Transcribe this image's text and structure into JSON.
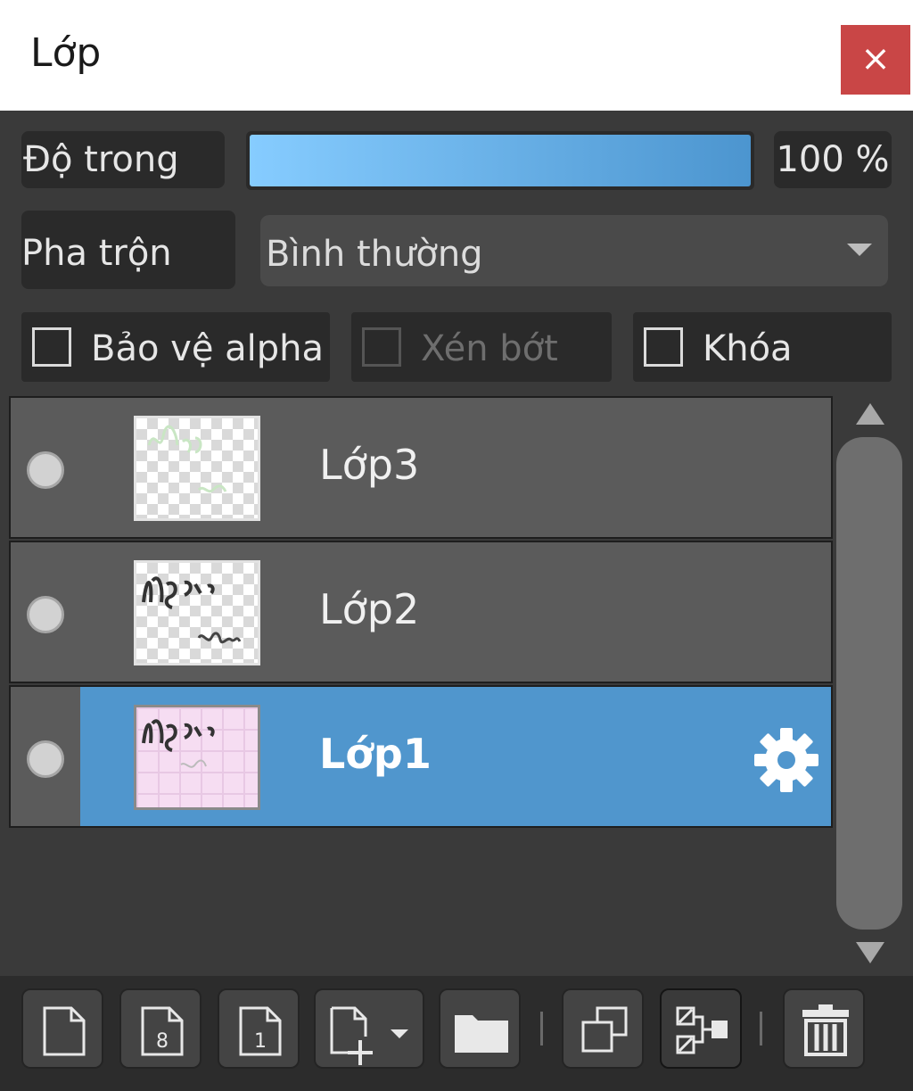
{
  "window": {
    "title": "Lớp",
    "close_label": "×"
  },
  "opacity": {
    "label": "Độ trong",
    "value_text": "100 %",
    "value": 100,
    "fill_color_start": "#86ccff",
    "fill_color_end": "#4c95cf"
  },
  "blend": {
    "label": "Pha trộn",
    "selected": "Bình thường"
  },
  "options": {
    "protect_alpha": {
      "label": "Bảo vệ alpha",
      "checked": false,
      "enabled": true
    },
    "clipping": {
      "label": "Xén bớt",
      "checked": false,
      "enabled": false
    },
    "lock": {
      "label": "Khóa",
      "checked": false,
      "enabled": true
    }
  },
  "layers": [
    {
      "name": "Lớp3",
      "selected": false,
      "visible": true
    },
    {
      "name": "Lớp2",
      "selected": false,
      "visible": true
    },
    {
      "name": "Lớp1",
      "selected": true,
      "visible": true
    }
  ],
  "colors": {
    "selected_layer": "#5096cd",
    "close_button": "#c94646"
  },
  "toolbar": {
    "icons": [
      "new-layer-icon",
      "new-8bit-layer-icon",
      "new-1bit-layer-icon",
      "add-layer-menu-icon",
      "new-folder-icon",
      "duplicate-layer-icon",
      "merge-down-icon",
      "delete-layer-icon"
    ]
  }
}
